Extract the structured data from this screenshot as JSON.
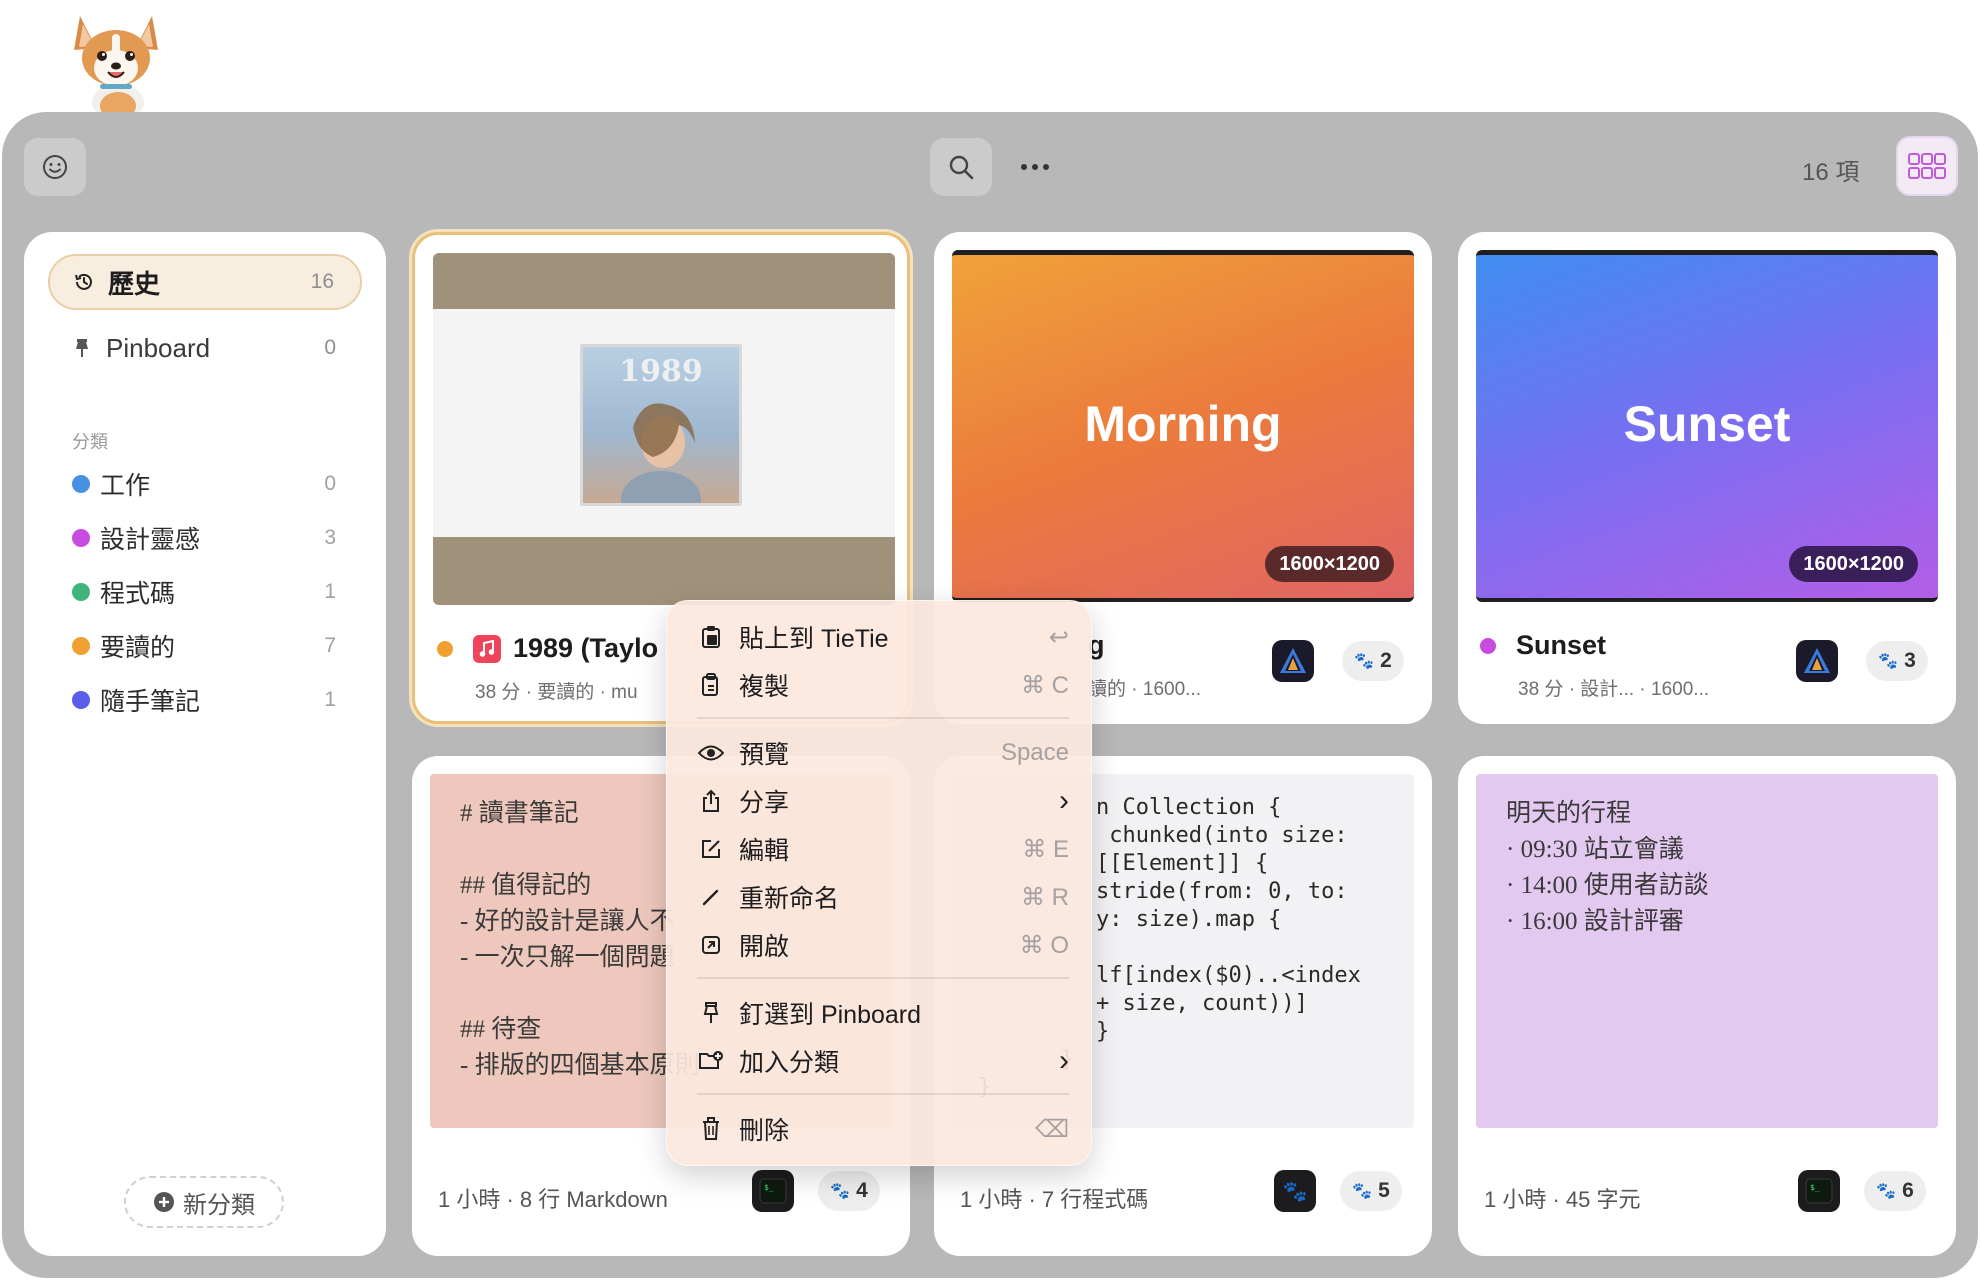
{
  "toolbar": {
    "item_count": "16 項"
  },
  "sidebar": {
    "history": {
      "label": "歷史",
      "count": "16"
    },
    "pinboard": {
      "label": "Pinboard",
      "count": "0"
    },
    "section_label": "分類",
    "categories": [
      {
        "label": "工作",
        "count": "0",
        "color": "#4a90e2"
      },
      {
        "label": "設計靈感",
        "count": "3",
        "color": "#c84be0"
      },
      {
        "label": "程式碼",
        "count": "1",
        "color": "#3fb57a"
      },
      {
        "label": "要讀的",
        "count": "7",
        "color": "#f0a030"
      },
      {
        "label": "隨手筆記",
        "count": "1",
        "color": "#5a5ee8"
      }
    ],
    "new_category": "新分類"
  },
  "cards": [
    {
      "title": "1989 (Taylo",
      "subtitle": "38 分 · 要讀的 · mu",
      "dot_color": "#f0a030",
      "album_art_text": "1989"
    },
    {
      "title": "g",
      "subtitle": "讀的 · 1600...",
      "thumb_title": "Morning",
      "resolution": "1600×1200",
      "paw_count": "2"
    },
    {
      "title": "Sunset",
      "subtitle": "38 分 · 設計... · 1600...",
      "dot_color": "#c84be0",
      "thumb_title": "Sunset",
      "resolution": "1600×1200",
      "paw_count": "3"
    },
    {
      "note": "# 讀書筆記\n\n## 值得記的\n- 好的設計是讓人不\n- 一次只解一個問題\n\n## 待查\n- 排版的四個基本原則",
      "footer": "1 小時 · 8 行 Markdown",
      "paw_count": "4"
    },
    {
      "code_lines": [
        "n Collection {",
        " chunked(into size:",
        "[[Element]] {",
        "stride(from: 0, to:",
        "y: size).map {",
        "",
        "lf[index($0)..<index",
        "+ size, count))]",
        "}",
        "  }",
        "}"
      ],
      "footer": "1 小時 · 7 行程式碼",
      "paw_count": "5"
    },
    {
      "note": "明天的行程\n· 09:30 站立會議\n· 14:00 使用者訪談\n· 16:00 設計評審",
      "footer": "1 小時 · 45 字元",
      "paw_count": "6"
    }
  ],
  "context_menu": {
    "paste": {
      "label": "貼上到 TieTie",
      "shortcut": "↩"
    },
    "copy": {
      "label": "複製",
      "shortcut": "⌘ C"
    },
    "preview": {
      "label": "預覽",
      "shortcut": "Space"
    },
    "share": {
      "label": "分享",
      "shortcut": "›"
    },
    "edit": {
      "label": "編輯",
      "shortcut": "⌘ E"
    },
    "rename": {
      "label": "重新命名",
      "shortcut": "⌘ R"
    },
    "open": {
      "label": "開啟",
      "shortcut": "⌘ O"
    },
    "pin": {
      "label": "釘選到 Pinboard"
    },
    "add_category": {
      "label": "加入分類",
      "shortcut": "›"
    },
    "delete": {
      "label": "刪除",
      "shortcut": "⌫"
    }
  }
}
